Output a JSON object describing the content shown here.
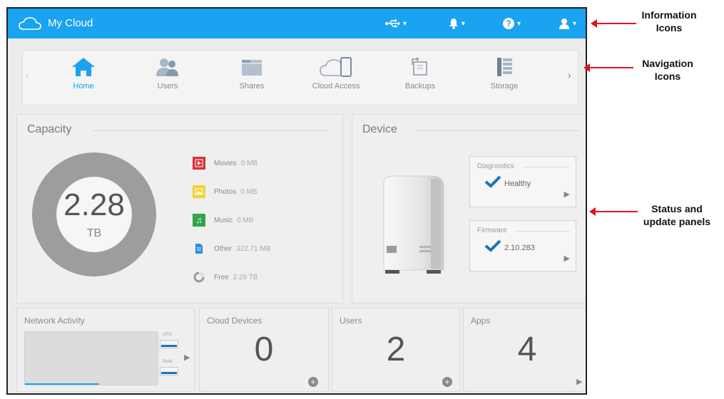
{
  "app": {
    "title": "My Cloud"
  },
  "topbar": {
    "icons": [
      {
        "name": "usb-icon",
        "caret": "▾"
      },
      {
        "name": "bell-icon",
        "caret": "▾"
      },
      {
        "name": "help-icon",
        "glyph": "?",
        "caret": "▾"
      },
      {
        "name": "user-icon",
        "caret": "▾"
      }
    ]
  },
  "nav": {
    "left_arrow": "‹",
    "right_arrow": "›",
    "items": [
      {
        "label": "Home",
        "icon": "home-icon",
        "active": true
      },
      {
        "label": "Users",
        "icon": "users-icon"
      },
      {
        "label": "Shares",
        "icon": "folder-icon"
      },
      {
        "label": "Cloud Access",
        "icon": "cloud-device-icon"
      },
      {
        "label": "Backups",
        "icon": "backup-icon"
      },
      {
        "label": "Storage",
        "icon": "storage-icon"
      }
    ]
  },
  "capacity": {
    "title": "Capacity",
    "total": "2.28",
    "unit": "TB",
    "used_fraction": 0.0002,
    "legend": [
      {
        "name": "Movies",
        "value": "0 MB",
        "color": "#d9303a",
        "icon": "movie-icon"
      },
      {
        "name": "Photos",
        "value": "0 MB",
        "color": "#f2d33c",
        "icon": "photo-icon"
      },
      {
        "name": "Music",
        "value": "0 MB",
        "color": "#33a447",
        "icon": "music-icon"
      },
      {
        "name": "Other",
        "value": "322.71 MB",
        "color": "#2f8ede",
        "icon": "document-icon"
      },
      {
        "name": "Free",
        "value": "2.28 TB",
        "color": "#9a9a9a",
        "icon": "free-space-icon"
      }
    ]
  },
  "device": {
    "title": "Device",
    "diagnostics": {
      "title": "Diagnostics",
      "value": "Healthy"
    },
    "firmware": {
      "title": "Firmware",
      "value": "2.10.283"
    }
  },
  "tiles": {
    "network": {
      "title": "Network Activity",
      "cpu_label": "CPU",
      "ram_label": "RAM"
    },
    "cloud_devices": {
      "title": "Cloud Devices",
      "count": "0"
    },
    "users": {
      "title": "Users",
      "count": "2"
    },
    "apps": {
      "title": "Apps",
      "count": "4"
    }
  },
  "annotations": {
    "info": "Information Icons",
    "nav": "Navigation Icons",
    "status": "Status and update panels"
  },
  "colors": {
    "accent": "#1aa3f0",
    "check": "#1a73b8",
    "annotation": "#e0141e"
  }
}
